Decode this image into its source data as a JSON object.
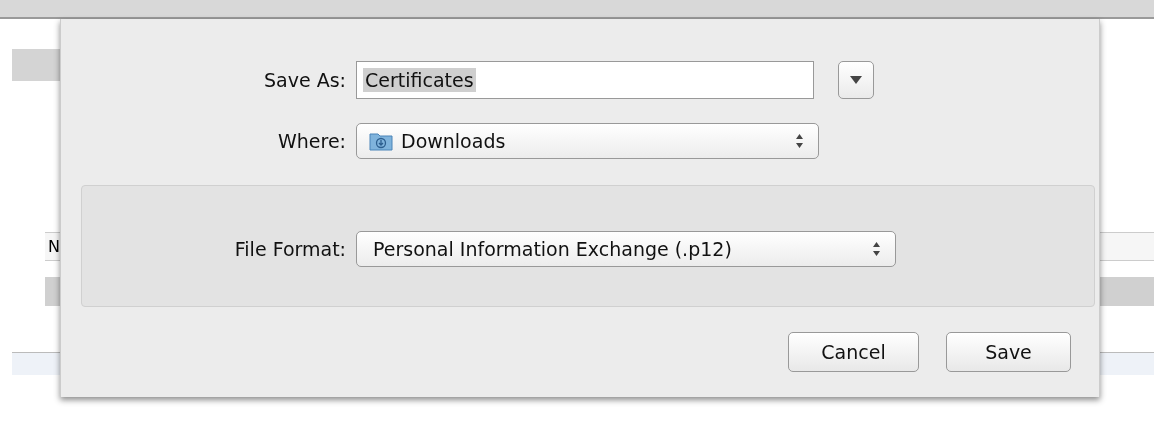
{
  "background": {
    "column_header": "N"
  },
  "sheet": {
    "save_as": {
      "label": "Save As:",
      "value": "Certificates"
    },
    "where": {
      "label": "Where:",
      "value": "Downloads"
    },
    "file_format": {
      "label": "File Format:",
      "value": "Personal Information Exchange (.p12)"
    },
    "buttons": [
      {
        "label": "Cancel",
        "kind": "cancel"
      },
      {
        "label": "Save",
        "kind": "default"
      }
    ]
  }
}
